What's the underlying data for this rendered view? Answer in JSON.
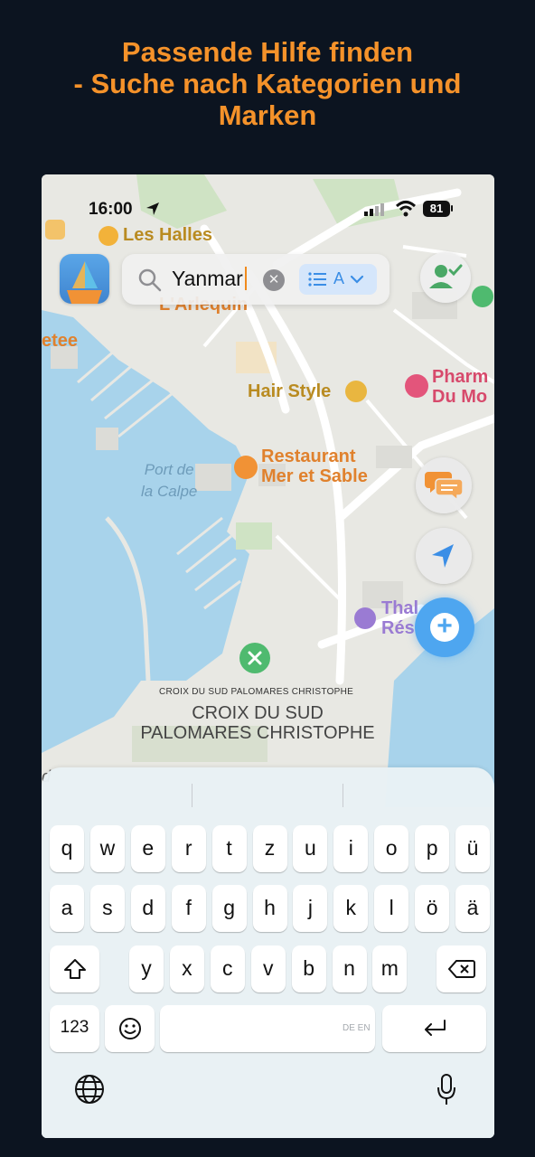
{
  "headline": {
    "line1": "Passende Hilfe finden",
    "line2": "- Suche nach Kategorien und",
    "line3": "Marken"
  },
  "status_bar": {
    "time": "16:00",
    "battery": "81",
    "icons": [
      "location-arrow-icon",
      "signal-icon",
      "wifi-icon",
      "battery-icon"
    ]
  },
  "search": {
    "value": "Yanmar",
    "filter_label": "A",
    "icons": [
      "search-icon",
      "clear-icon",
      "list-icon",
      "chevron-down-icon"
    ]
  },
  "map": {
    "labels": {
      "les_halles": "Les Halles",
      "arlequin": "L'Arlequin",
      "etee": "etee",
      "pharm_line1": "Pharm",
      "pharm_line2": "Du Mo",
      "hair_style": "Hair Style",
      "restaurant_line1": "Restaurant",
      "restaurant_line2": "Mer et Sable",
      "port_line1": "Port de",
      "port_line2": "la Calpe",
      "thal_line1": "Thal",
      "thal_line2": "Rés",
      "croix_small": "CROIX DU SUD PALOMARES CHRISTOPHE",
      "croix_line1": "CROIX DU SUD",
      "croix_line2": "PALOMARES CHRISTOPHE",
      "d": "d"
    }
  },
  "keyboard": {
    "row1": [
      "q",
      "w",
      "e",
      "r",
      "t",
      "z",
      "u",
      "i",
      "o",
      "p",
      "ü"
    ],
    "row2": [
      "a",
      "s",
      "d",
      "f",
      "g",
      "h",
      "j",
      "k",
      "l",
      "ö",
      "ä"
    ],
    "row3": [
      "y",
      "x",
      "c",
      "v",
      "b",
      "n",
      "m"
    ],
    "numbers_label": "123",
    "language_hint": "DE EN"
  },
  "colors": {
    "headline": "#f5922a",
    "background": "#0c1420",
    "accent_blue": "#4ea6f0"
  }
}
